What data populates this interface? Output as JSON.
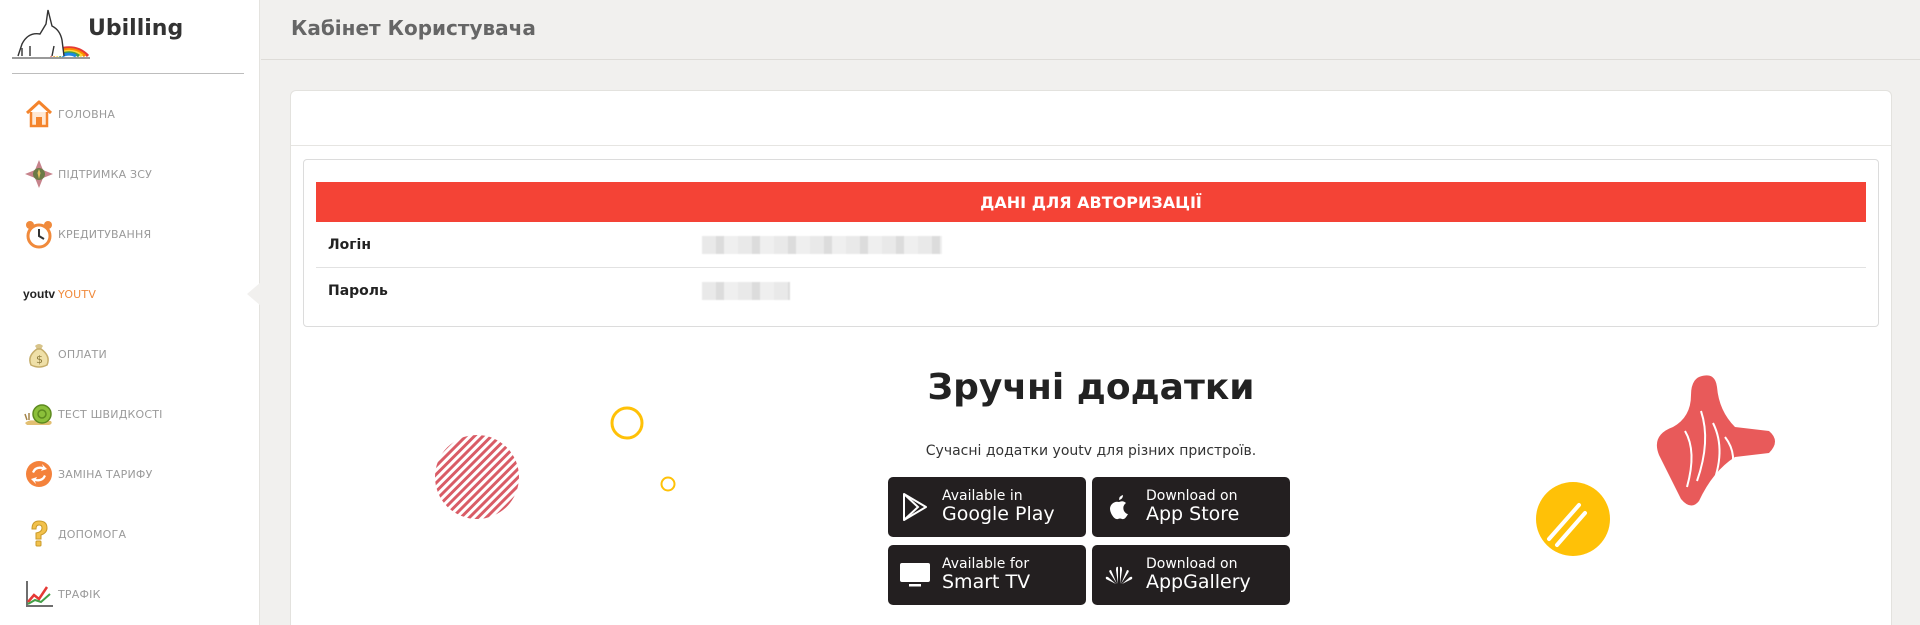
{
  "brand": {
    "name": "Ubilling"
  },
  "header": {
    "title": "Кабінет Користувача"
  },
  "sidebar": {
    "items": [
      {
        "label": "ГОЛОВНА",
        "icon": "home-icon"
      },
      {
        "label": "ПІДТРИМКА ЗСУ",
        "icon": "army-emblem-icon"
      },
      {
        "label": "КРЕДИТУВАННЯ",
        "icon": "alarm-clock-icon"
      },
      {
        "label": "YOUTV",
        "icon": "youtv-logo-icon",
        "logo_text": "youtv",
        "active": true
      },
      {
        "label": "ОПЛАТИ",
        "icon": "money-bag-icon"
      },
      {
        "label": "ТЕСТ ШВИДКОСТІ",
        "icon": "snail-icon"
      },
      {
        "label": "ЗАМІНА ТАРИФУ",
        "icon": "tariff-change-icon"
      },
      {
        "label": "ДОПОМОГА",
        "icon": "question-icon"
      },
      {
        "label": "ТРАФІК",
        "icon": "traffic-chart-icon"
      }
    ]
  },
  "auth": {
    "title": "ДАНІ ДЛЯ АВТОРИЗАЦІЇ",
    "login_label": "Логін",
    "password_label": "Пароль"
  },
  "apps": {
    "title": "Зручні додатки",
    "subtitle": "Сучасні додатки youtv для різних пристроїв.",
    "buttons": [
      {
        "line1": "Available in",
        "line2": "Google Play",
        "icon": "google-play-icon"
      },
      {
        "line1": "Download on",
        "line2": "App Store",
        "icon": "apple-icon"
      },
      {
        "line1": "Available for",
        "line2": "Smart TV",
        "icon": "tv-icon"
      },
      {
        "line1": "Download on",
        "line2": "AppGallery",
        "icon": "huawei-icon"
      }
    ]
  },
  "colors": {
    "accent": "#f44336",
    "active_nav": "#f08a3c",
    "store_button": "#231f20",
    "deco_yellow": "#ffc107",
    "deco_red": "#e85a5a"
  }
}
